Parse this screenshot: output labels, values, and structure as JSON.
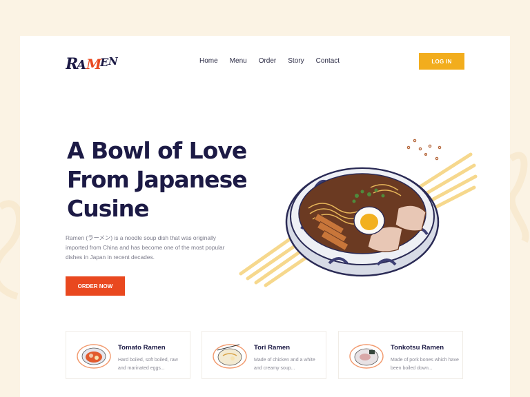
{
  "brand": {
    "logo_text": "RAMEN",
    "accent_color": "#e9481f",
    "secondary_color": "#f2ad1d"
  },
  "nav": {
    "items": [
      {
        "label": "Home"
      },
      {
        "label": "Menu"
      },
      {
        "label": "Order"
      },
      {
        "label": "Story"
      },
      {
        "label": "Contact"
      }
    ],
    "login_label": "LOG IN"
  },
  "hero": {
    "title": "A Bowl of Love\nFrom Japanese\nCusine",
    "description": "Ramen (ラーメン) is a noodle soup dish that was originally imported from China and has become one of the most popular dishes in Japan in recent decades.",
    "cta_label": "ORDER NOW",
    "image_icon": "ramen-bowl-illustration"
  },
  "menu_cards": [
    {
      "name": "Tomato Ramen",
      "description": "Hard boiled, soft boiled, raw and marinated eggs...",
      "icon": "tomato-ramen-plate"
    },
    {
      "name": "Tori Ramen",
      "description": "Made of chicken and a white and creamy soup...",
      "icon": "tori-ramen-plate"
    },
    {
      "name": "Tonkotsu Ramen",
      "description": "Made of pork bones which have been boiled down...",
      "icon": "tonkotsu-ramen-plate"
    }
  ]
}
